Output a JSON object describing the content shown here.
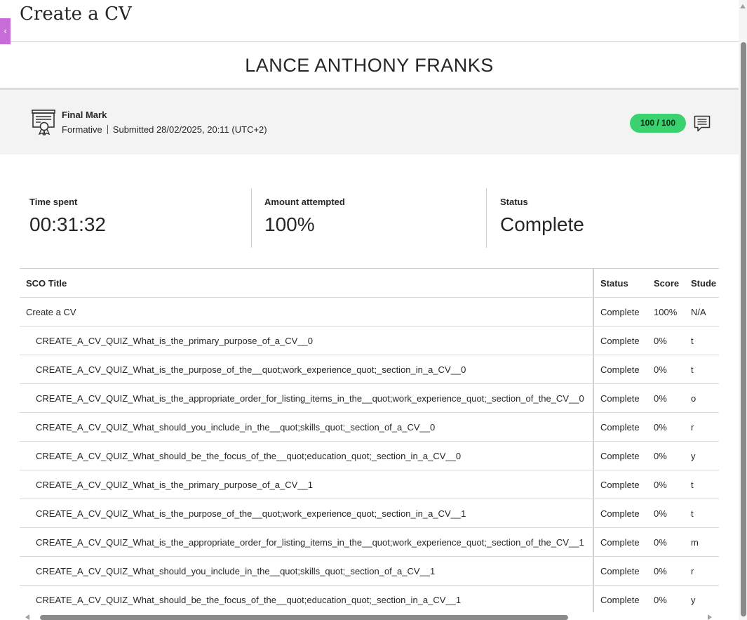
{
  "header": {
    "back_glyph": "‹",
    "title": "Create a CV"
  },
  "student": {
    "name": "LANCE ANTHONY FRANKS"
  },
  "grade": {
    "label": "Final Mark",
    "type": "Formative",
    "submitted": "Submitted 28/02/2025, 20:11 (UTC+2)",
    "score": "100 / 100",
    "pill_color": "#3ad26e"
  },
  "stats": {
    "time_spent_label": "Time spent",
    "time_spent_value": "00:31:32",
    "amount_label": "Amount attempted",
    "amount_value": "100%",
    "status_label": "Status",
    "status_value": "Complete"
  },
  "table": {
    "headers": [
      "SCO Title",
      "Status",
      "Score",
      "Stude"
    ],
    "rows": [
      {
        "title": "Create a CV",
        "status": "Complete",
        "score": "100%",
        "student": "N/A",
        "indent": false
      },
      {
        "title": "CREATE_A_CV_QUIZ_What_is_the_primary_purpose_of_a_CV__0",
        "status": "Complete",
        "score": "0%",
        "student": "t",
        "indent": true
      },
      {
        "title": "CREATE_A_CV_QUIZ_What_is_the_purpose_of_the__quot;work_experience_quot;_section_in_a_CV__0",
        "status": "Complete",
        "score": "0%",
        "student": "t",
        "indent": true
      },
      {
        "title": "CREATE_A_CV_QUIZ_What_is_the_appropriate_order_for_listing_items_in_the__quot;work_experience_quot;_section_of_the_CV__0",
        "status": "Complete",
        "score": "0%",
        "student": "o",
        "indent": true
      },
      {
        "title": "CREATE_A_CV_QUIZ_What_should_you_include_in_the__quot;skills_quot;_section_of_a_CV__0",
        "status": "Complete",
        "score": "0%",
        "student": "r",
        "indent": true
      },
      {
        "title": "CREATE_A_CV_QUIZ_What_should_be_the_focus_of_the__quot;education_quot;_section_in_a_CV__0",
        "status": "Complete",
        "score": "0%",
        "student": "y",
        "indent": true
      },
      {
        "title": "CREATE_A_CV_QUIZ_What_is_the_primary_purpose_of_a_CV__1",
        "status": "Complete",
        "score": "0%",
        "student": "t",
        "indent": true
      },
      {
        "title": "CREATE_A_CV_QUIZ_What_is_the_purpose_of_the__quot;work_experience_quot;_section_in_a_CV__1",
        "status": "Complete",
        "score": "0%",
        "student": "t",
        "indent": true
      },
      {
        "title": "CREATE_A_CV_QUIZ_What_is_the_appropriate_order_for_listing_items_in_the__quot;work_experience_quot;_section_of_the_CV__1",
        "status": "Complete",
        "score": "0%",
        "student": "m",
        "indent": true
      },
      {
        "title": "CREATE_A_CV_QUIZ_What_should_you_include_in_the__quot;skills_quot;_section_of_a_CV__1",
        "status": "Complete",
        "score": "0%",
        "student": "r",
        "indent": true
      },
      {
        "title": "CREATE_A_CV_QUIZ_What_should_be_the_focus_of_the__quot;education_quot;_section_in_a_CV__1",
        "status": "Complete",
        "score": "0%",
        "student": "y",
        "indent": true
      }
    ]
  }
}
